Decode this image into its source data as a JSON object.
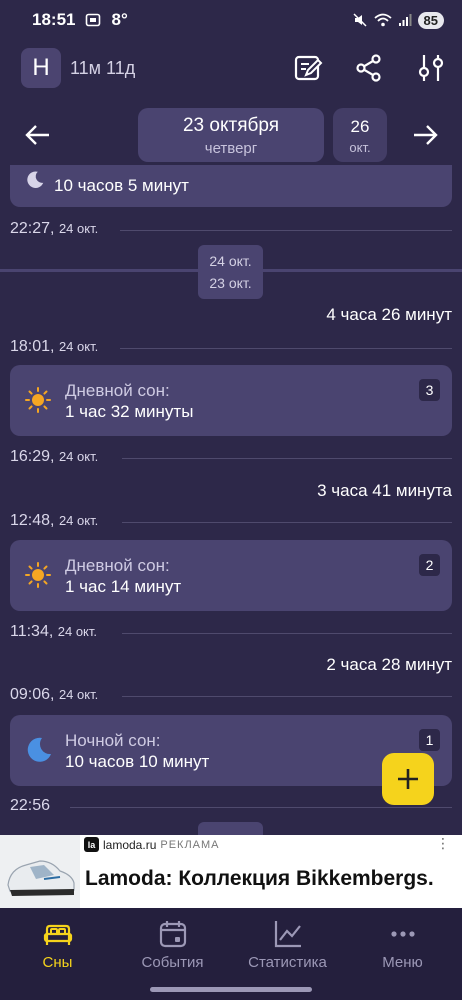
{
  "status_bar": {
    "time": "18:51",
    "temp": "8°",
    "battery": "85"
  },
  "header": {
    "avatar_letter": "Н",
    "age": "11м 11д"
  },
  "date_nav": {
    "current_date": "23 октября",
    "current_weekday": "четверг",
    "next_day": "26",
    "next_month": "окт."
  },
  "feed": {
    "top_card_value": "10 часов 5 минут",
    "t1": {
      "time": "22:27,",
      "date": "24 окт."
    },
    "day_box": {
      "line1": "24 окт.",
      "line2": "23 окт."
    },
    "gap1": "4 часа 26 минут",
    "t2": {
      "time": "18:01,",
      "date": "24 окт."
    },
    "card1": {
      "label": "Дневной сон:",
      "value": "1 час 32 минуты",
      "num": "3"
    },
    "t3": {
      "time": "16:29,",
      "date": "24 окт."
    },
    "gap2": "3 часа 41 минута",
    "t4": {
      "time": "12:48,",
      "date": "24 окт."
    },
    "card2": {
      "label": "Дневной сон:",
      "value": "1 час 14 минут",
      "num": "2"
    },
    "t5": {
      "time": "11:34,",
      "date": "24 окт."
    },
    "gap3": "2 часа 28 минут",
    "t6": {
      "time": "09:06,",
      "date": "24 окт."
    },
    "card3": {
      "label": "Ночной сон:",
      "value": "10 часов 10 минут",
      "num": "1"
    },
    "t7": {
      "time": "22:56"
    }
  },
  "ad": {
    "source": "lamoda.ru",
    "tag": "РЕКЛАМА",
    "headline": "Lamoda: Коллекция Bikkembergs.",
    "logo": "la"
  },
  "bottom_nav": [
    {
      "label": "Сны",
      "icon": "bed-icon",
      "active": true
    },
    {
      "label": "События",
      "icon": "calendar-icon",
      "active": false
    },
    {
      "label": "Статистика",
      "icon": "chart-icon",
      "active": false
    },
    {
      "label": "Меню",
      "icon": "more-icon",
      "active": false
    }
  ],
  "colors": {
    "background": "#2d2849",
    "card": "#4a4470",
    "accent": "#f5d31c",
    "sun": "#f5a623",
    "moon": "#4a90e2"
  }
}
